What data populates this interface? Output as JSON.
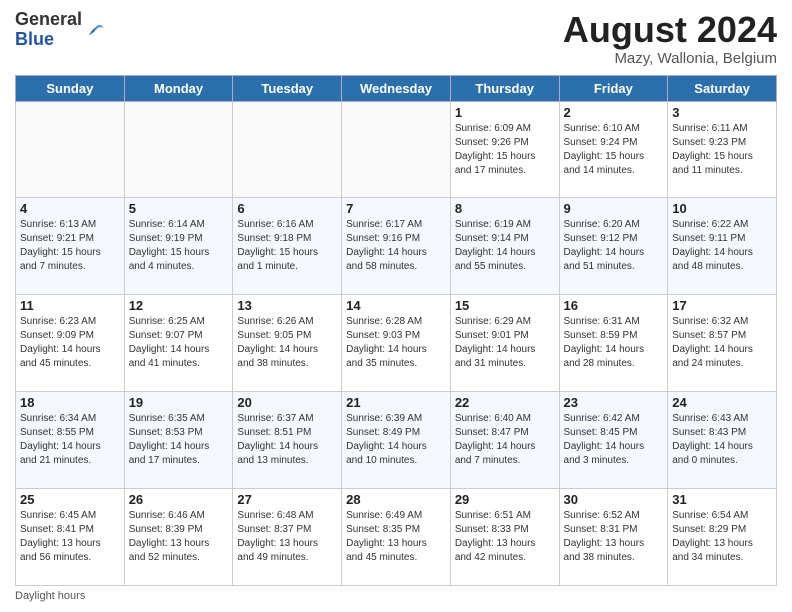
{
  "header": {
    "logo_line1": "General",
    "logo_line2": "Blue",
    "month_year": "August 2024",
    "location": "Mazy, Wallonia, Belgium"
  },
  "days_of_week": [
    "Sunday",
    "Monday",
    "Tuesday",
    "Wednesday",
    "Thursday",
    "Friday",
    "Saturday"
  ],
  "weeks": [
    [
      {
        "day": "",
        "info": ""
      },
      {
        "day": "",
        "info": ""
      },
      {
        "day": "",
        "info": ""
      },
      {
        "day": "",
        "info": ""
      },
      {
        "day": "1",
        "info": "Sunrise: 6:09 AM\nSunset: 9:26 PM\nDaylight: 15 hours and 17 minutes."
      },
      {
        "day": "2",
        "info": "Sunrise: 6:10 AM\nSunset: 9:24 PM\nDaylight: 15 hours and 14 minutes."
      },
      {
        "day": "3",
        "info": "Sunrise: 6:11 AM\nSunset: 9:23 PM\nDaylight: 15 hours and 11 minutes."
      }
    ],
    [
      {
        "day": "4",
        "info": "Sunrise: 6:13 AM\nSunset: 9:21 PM\nDaylight: 15 hours and 7 minutes."
      },
      {
        "day": "5",
        "info": "Sunrise: 6:14 AM\nSunset: 9:19 PM\nDaylight: 15 hours and 4 minutes."
      },
      {
        "day": "6",
        "info": "Sunrise: 6:16 AM\nSunset: 9:18 PM\nDaylight: 15 hours and 1 minute."
      },
      {
        "day": "7",
        "info": "Sunrise: 6:17 AM\nSunset: 9:16 PM\nDaylight: 14 hours and 58 minutes."
      },
      {
        "day": "8",
        "info": "Sunrise: 6:19 AM\nSunset: 9:14 PM\nDaylight: 14 hours and 55 minutes."
      },
      {
        "day": "9",
        "info": "Sunrise: 6:20 AM\nSunset: 9:12 PM\nDaylight: 14 hours and 51 minutes."
      },
      {
        "day": "10",
        "info": "Sunrise: 6:22 AM\nSunset: 9:11 PM\nDaylight: 14 hours and 48 minutes."
      }
    ],
    [
      {
        "day": "11",
        "info": "Sunrise: 6:23 AM\nSunset: 9:09 PM\nDaylight: 14 hours and 45 minutes."
      },
      {
        "day": "12",
        "info": "Sunrise: 6:25 AM\nSunset: 9:07 PM\nDaylight: 14 hours and 41 minutes."
      },
      {
        "day": "13",
        "info": "Sunrise: 6:26 AM\nSunset: 9:05 PM\nDaylight: 14 hours and 38 minutes."
      },
      {
        "day": "14",
        "info": "Sunrise: 6:28 AM\nSunset: 9:03 PM\nDaylight: 14 hours and 35 minutes."
      },
      {
        "day": "15",
        "info": "Sunrise: 6:29 AM\nSunset: 9:01 PM\nDaylight: 14 hours and 31 minutes."
      },
      {
        "day": "16",
        "info": "Sunrise: 6:31 AM\nSunset: 8:59 PM\nDaylight: 14 hours and 28 minutes."
      },
      {
        "day": "17",
        "info": "Sunrise: 6:32 AM\nSunset: 8:57 PM\nDaylight: 14 hours and 24 minutes."
      }
    ],
    [
      {
        "day": "18",
        "info": "Sunrise: 6:34 AM\nSunset: 8:55 PM\nDaylight: 14 hours and 21 minutes."
      },
      {
        "day": "19",
        "info": "Sunrise: 6:35 AM\nSunset: 8:53 PM\nDaylight: 14 hours and 17 minutes."
      },
      {
        "day": "20",
        "info": "Sunrise: 6:37 AM\nSunset: 8:51 PM\nDaylight: 14 hours and 13 minutes."
      },
      {
        "day": "21",
        "info": "Sunrise: 6:39 AM\nSunset: 8:49 PM\nDaylight: 14 hours and 10 minutes."
      },
      {
        "day": "22",
        "info": "Sunrise: 6:40 AM\nSunset: 8:47 PM\nDaylight: 14 hours and 7 minutes."
      },
      {
        "day": "23",
        "info": "Sunrise: 6:42 AM\nSunset: 8:45 PM\nDaylight: 14 hours and 3 minutes."
      },
      {
        "day": "24",
        "info": "Sunrise: 6:43 AM\nSunset: 8:43 PM\nDaylight: 14 hours and 0 minutes."
      }
    ],
    [
      {
        "day": "25",
        "info": "Sunrise: 6:45 AM\nSunset: 8:41 PM\nDaylight: 13 hours and 56 minutes."
      },
      {
        "day": "26",
        "info": "Sunrise: 6:46 AM\nSunset: 8:39 PM\nDaylight: 13 hours and 52 minutes."
      },
      {
        "day": "27",
        "info": "Sunrise: 6:48 AM\nSunset: 8:37 PM\nDaylight: 13 hours and 49 minutes."
      },
      {
        "day": "28",
        "info": "Sunrise: 6:49 AM\nSunset: 8:35 PM\nDaylight: 13 hours and 45 minutes."
      },
      {
        "day": "29",
        "info": "Sunrise: 6:51 AM\nSunset: 8:33 PM\nDaylight: 13 hours and 42 minutes."
      },
      {
        "day": "30",
        "info": "Sunrise: 6:52 AM\nSunset: 8:31 PM\nDaylight: 13 hours and 38 minutes."
      },
      {
        "day": "31",
        "info": "Sunrise: 6:54 AM\nSunset: 8:29 PM\nDaylight: 13 hours and 34 minutes."
      }
    ]
  ],
  "footer": {
    "daylight_label": "Daylight hours"
  }
}
